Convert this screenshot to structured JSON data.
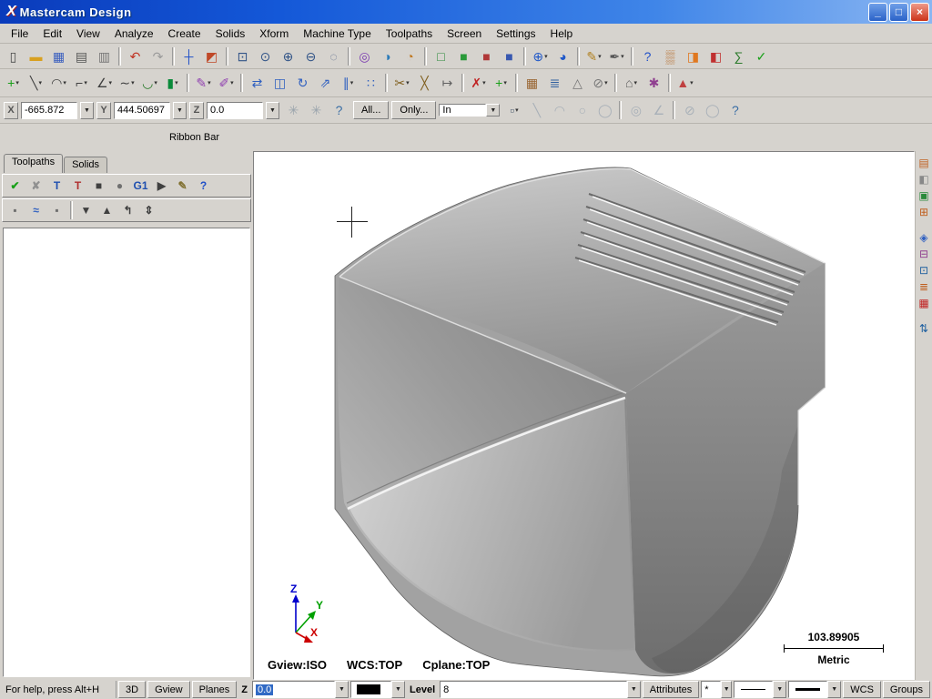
{
  "ui": {
    "combo_glyph": "▼",
    "dropdown_glyph": "▾"
  },
  "window": {
    "title": "Mastercam Design",
    "logo_glyph": "X",
    "minimize_glyph": "_",
    "maximize_glyph": "□",
    "close_glyph": "×"
  },
  "menu": [
    {
      "name": "menu-file",
      "label": "File"
    },
    {
      "name": "menu-edit",
      "label": "Edit"
    },
    {
      "name": "menu-view",
      "label": "View"
    },
    {
      "name": "menu-analyze",
      "label": "Analyze"
    },
    {
      "name": "menu-create",
      "label": "Create"
    },
    {
      "name": "menu-solids",
      "label": "Solids"
    },
    {
      "name": "menu-xform",
      "label": "Xform"
    },
    {
      "name": "menu-machine-type",
      "label": "Machine Type"
    },
    {
      "name": "menu-toolpaths",
      "label": "Toolpaths"
    },
    {
      "name": "menu-screen",
      "label": "Screen"
    },
    {
      "name": "menu-settings",
      "label": "Settings"
    },
    {
      "name": "menu-help",
      "label": "Help"
    }
  ],
  "toolbar1": [
    {
      "name": "new-file-icon",
      "glyph": "▯",
      "color": "#4a4a4a"
    },
    {
      "name": "open-file-icon",
      "glyph": "▬",
      "color": "#d8a020"
    },
    {
      "name": "save-icon",
      "glyph": "▦",
      "color": "#3a5fbf"
    },
    {
      "name": "print-icon",
      "glyph": "▤",
      "color": "#555555"
    },
    {
      "name": "print-preview-icon",
      "glyph": "▥",
      "color": "#777777"
    },
    {
      "sep": true
    },
    {
      "name": "undo-icon",
      "glyph": "↶",
      "color": "#c03020"
    },
    {
      "name": "redo-icon",
      "glyph": "↷",
      "color": "#9a9a9a"
    },
    {
      "sep": true
    },
    {
      "name": "gnomon-icon",
      "glyph": "┼",
      "color": "#2050c8"
    },
    {
      "name": "repaint-icon",
      "glyph": "◩",
      "color": "#c04828"
    },
    {
      "sep": true
    },
    {
      "name": "zoom-window-icon",
      "glyph": "⊡",
      "color": "#335588"
    },
    {
      "name": "zoom-target-icon",
      "glyph": "⊙",
      "color": "#335588"
    },
    {
      "name": "zoom-in-icon",
      "glyph": "⊕",
      "color": "#335588"
    },
    {
      "name": "zoom-out-icon",
      "glyph": "⊖",
      "color": "#335588"
    },
    {
      "name": "unzoom-icon",
      "glyph": "◌",
      "color": "#556688"
    },
    {
      "sep": true
    },
    {
      "name": "analyze-entity-icon",
      "glyph": "◎",
      "color": "#7a3ab0"
    },
    {
      "name": "analyze-position-icon",
      "glyph": "◑",
      "color": "#2a7ab8"
    },
    {
      "name": "analyze-chain-icon",
      "glyph": "◔",
      "color": "#c07820"
    },
    {
      "sep": true
    },
    {
      "name": "wireframe-view-icon",
      "glyph": "□",
      "color": "#2a8a3a"
    },
    {
      "name": "shaded-view-icon",
      "glyph": "■",
      "color": "#2a9a3a"
    },
    {
      "name": "shaded-edges-icon",
      "glyph": "■",
      "color": "#b03838"
    },
    {
      "name": "shaded-materials-icon",
      "glyph": "■",
      "color": "#3858b0"
    },
    {
      "sep": true
    },
    {
      "name": "rotate-view-icon",
      "glyph": "⊕",
      "color": "#2058c8",
      "dd": true
    },
    {
      "name": "dynamic-spin-icon",
      "glyph": "◕",
      "color": "#2058c8"
    },
    {
      "sep": true
    },
    {
      "name": "entity-color-icon",
      "glyph": "✎",
      "color": "#b08020",
      "dd": true
    },
    {
      "name": "entity-attributes-icon",
      "glyph": "✒",
      "color": "#555555",
      "dd": true
    },
    {
      "sep": true
    },
    {
      "name": "help-icon",
      "glyph": "?",
      "color": "#2050c8"
    },
    {
      "name": "grid-settings-icon",
      "glyph": "▒",
      "color": "#b87333"
    },
    {
      "name": "run-addin-icon",
      "glyph": "◨",
      "color": "#e07820"
    },
    {
      "name": "vba-icon",
      "glyph": "◧",
      "color": "#c03030"
    },
    {
      "name": "sigma-icon",
      "glyph": "∑",
      "color": "#2a7a2a"
    },
    {
      "name": "ok-icon",
      "glyph": "✓",
      "color": "#18a018"
    }
  ],
  "toolbar2": [
    {
      "name": "create-point-icon",
      "glyph": "+",
      "color": "#18a018",
      "dd": true
    },
    {
      "name": "create-line-icon",
      "glyph": "╲",
      "color": "#404040",
      "dd": true
    },
    {
      "name": "create-arc-icon",
      "glyph": "◠",
      "color": "#404040",
      "dd": true
    },
    {
      "name": "create-fillet-icon",
      "glyph": "⌐",
      "color": "#404040",
      "dd": true
    },
    {
      "name": "create-chamfer-icon",
      "glyph": "∠",
      "color": "#404040",
      "dd": true
    },
    {
      "name": "create-spline-icon",
      "glyph": "∼",
      "color": "#404040",
      "dd": true
    },
    {
      "name": "create-curve-icon",
      "glyph": "◡",
      "color": "#2a7a2a",
      "dd": true
    },
    {
      "name": "create-solid-icon",
      "glyph": "▮",
      "color": "#0a8a3a",
      "dd": true
    },
    {
      "sep": true
    },
    {
      "name": "drafting-dimension-icon",
      "glyph": "✎",
      "color": "#9040b0",
      "dd": true
    },
    {
      "name": "drafting-note-icon",
      "glyph": "✐",
      "color": "#9040b0",
      "dd": true
    },
    {
      "sep": true
    },
    {
      "name": "xform-translate-icon",
      "glyph": "⇄",
      "color": "#3060c0"
    },
    {
      "name": "xform-mirror-icon",
      "glyph": "◫",
      "color": "#3060c0"
    },
    {
      "name": "xform-rotate-icon",
      "glyph": "↻",
      "color": "#3060c0"
    },
    {
      "name": "xform-scale-icon",
      "glyph": "⇗",
      "color": "#3060c0"
    },
    {
      "name": "xform-offset-icon",
      "glyph": "∥",
      "color": "#3060c0",
      "dd": true
    },
    {
      "name": "xform-array-icon",
      "glyph": "∷",
      "color": "#3060c0"
    },
    {
      "sep": true
    },
    {
      "name": "trim-icon",
      "glyph": "✂",
      "color": "#806020",
      "dd": true
    },
    {
      "name": "break-icon",
      "glyph": "╳",
      "color": "#806020"
    },
    {
      "name": "join-icon",
      "glyph": "↦",
      "color": "#606060"
    },
    {
      "sep": true
    },
    {
      "name": "delete-icon",
      "glyph": "✗",
      "color": "#c02020",
      "dd": true
    },
    {
      "name": "undelete-icon",
      "glyph": "+",
      "color": "#18a018",
      "dd": true
    },
    {
      "sep": true
    },
    {
      "name": "screen-grid-icon",
      "glyph": "▦",
      "color": "#996633"
    },
    {
      "name": "screen-levels-icon",
      "glyph": "≣",
      "color": "#3060a0"
    },
    {
      "name": "screen-statistics-icon",
      "glyph": "△",
      "color": "#777777"
    },
    {
      "name": "screen-blank-icon",
      "glyph": "⊘",
      "color": "#777777",
      "dd": true
    },
    {
      "sep": true
    },
    {
      "name": "wcs-view-icon",
      "glyph": "⌂",
      "color": "#606060",
      "dd": true
    },
    {
      "name": "config-icon",
      "glyph": "✱",
      "color": "#904090"
    },
    {
      "sep": true
    },
    {
      "name": "material-icon",
      "glyph": "▲",
      "color": "#c04040",
      "dd": true
    }
  ],
  "ribbon": {
    "x_label": "X",
    "x_value": "-665.872",
    "y_label": "Y",
    "y_value": "444.50697",
    "z_label": "Z",
    "z_value": "0.0",
    "mid_icons": [
      {
        "name": "fastpoint-icon",
        "glyph": "✳",
        "color": "#9aa4ac"
      },
      {
        "name": "point-snap-icon",
        "glyph": "✳",
        "color": "#9aa4ac"
      },
      {
        "name": "ribbon-help-icon",
        "glyph": "?",
        "color": "#3a6ea5"
      }
    ],
    "all_button": "All...",
    "only_button": "Only...",
    "units_value": "In",
    "right_icons": [
      {
        "name": "selection-window-icon",
        "glyph": "▫",
        "color": "#556677",
        "dd": true
      },
      {
        "name": "chain-line-icon",
        "glyph": "╲",
        "color": "#a8b0b8"
      },
      {
        "name": "chain-arc-icon",
        "glyph": "◠",
        "color": "#a8b0b8"
      },
      {
        "name": "chain-circle-icon",
        "glyph": "○",
        "color": "#a8b0b8"
      },
      {
        "name": "chain-full-icon",
        "glyph": "◯",
        "color": "#a8b0b8"
      },
      {
        "sep": true
      },
      {
        "name": "select-result-icon",
        "glyph": "◎",
        "color": "#a8b0b8"
      },
      {
        "name": "select-angle-icon",
        "glyph": "∠",
        "color": "#a8b0b8"
      },
      {
        "sep": true
      },
      {
        "name": "select-validate-icon",
        "glyph": "⊘",
        "color": "#a8b0b8"
      },
      {
        "name": "select-last-icon",
        "glyph": "◯",
        "color": "#a8b0b8"
      },
      {
        "name": "selection-help-icon",
        "glyph": "?",
        "color": "#3a6ea5"
      }
    ]
  },
  "ribbon_label": "Ribbon Bar",
  "left_panel": {
    "tabs": [
      {
        "name": "tab-toolpaths",
        "label": "Toolpaths",
        "active": true
      },
      {
        "name": "tab-solids",
        "label": "Solids"
      }
    ],
    "row1": [
      {
        "name": "select-all-operations-icon",
        "glyph": "✔",
        "color": "#18a018"
      },
      {
        "name": "unselect-all-operations-icon",
        "glyph": "✘",
        "color": "#909090"
      },
      {
        "name": "regen-selected-icon",
        "glyph": "T",
        "color": "#2050b0"
      },
      {
        "name": "regen-dirty-icon",
        "glyph": "T",
        "color": "#b03030"
      },
      {
        "name": "backplot-icon",
        "glyph": "■",
        "color": "#404040"
      },
      {
        "name": "verify-icon",
        "glyph": "●",
        "color": "#707070"
      },
      {
        "name": "post-g1-icon",
        "glyph": "G1",
        "color": "#2050b0"
      },
      {
        "name": "highfeed-icon",
        "glyph": "▶",
        "color": "#404040"
      },
      {
        "name": "edit-operation-icon",
        "glyph": "✎",
        "color": "#807030"
      },
      {
        "name": "panel-help-icon",
        "glyph": "?",
        "color": "#2050c8"
      }
    ],
    "row2": [
      {
        "name": "lock-icon",
        "glyph": "▪",
        "color": "#707070"
      },
      {
        "name": "toolpath-display-icon",
        "glyph": "≈",
        "color": "#3060c0"
      },
      {
        "name": "lock-display-icon",
        "glyph": "▪",
        "color": "#707070"
      },
      {
        "sep": true
      },
      {
        "name": "move-down-icon",
        "glyph": "▼",
        "color": "#404040"
      },
      {
        "name": "move-up-icon",
        "glyph": "▲",
        "color": "#404040"
      },
      {
        "name": "insert-above-icon",
        "glyph": "↰",
        "color": "#404040"
      },
      {
        "name": "scroll-ops-icon",
        "glyph": "⇕",
        "color": "#404040"
      }
    ]
  },
  "viewport": {
    "gview_label": "Gview:ISO",
    "wcs_label": "WCS:TOP",
    "cplane_label": "Cplane:TOP",
    "scale_value": "103.89905",
    "scale_units": "Metric",
    "axis_x": "X",
    "axis_y": "Y",
    "axis_z": "Z"
  },
  "right_toolbar": [
    {
      "name": "raster-image-icon",
      "glyph": "▤",
      "color": "#c06020"
    },
    {
      "name": "gradient-icon",
      "glyph": "◧",
      "color": "#888888"
    },
    {
      "name": "to-clipboard-icon",
      "glyph": "▣",
      "color": "#2a8a3a"
    },
    {
      "name": "grid-capture-icon",
      "glyph": "⊞",
      "color": "#c06020"
    },
    {
      "gap": true
    },
    {
      "name": "diamond-tool-icon",
      "glyph": "◈",
      "color": "#3060c0"
    },
    {
      "name": "box-tool-icon",
      "glyph": "⊟",
      "color": "#904090"
    },
    {
      "name": "target-tool-icon",
      "glyph": "⊡",
      "color": "#2060a0"
    },
    {
      "name": "list-tool-icon",
      "glyph": "≣",
      "color": "#c06020"
    },
    {
      "name": "red-grid-icon",
      "glyph": "▦",
      "color": "#c02020"
    },
    {
      "gap": true
    },
    {
      "name": "updown-tool-icon",
      "glyph": "⇅",
      "color": "#2060a0"
    }
  ],
  "statusbar": {
    "help_text": "For help, press Alt+H",
    "btn_3d": "3D",
    "btn_gview": "Gview",
    "btn_planes": "Planes",
    "z_label": "Z",
    "z_value": "0.0",
    "level_label": "Level",
    "level_value": "8",
    "btn_attributes": "Attributes",
    "point_style": "*",
    "btn_wcs": "WCS",
    "btn_groups": "Groups"
  }
}
